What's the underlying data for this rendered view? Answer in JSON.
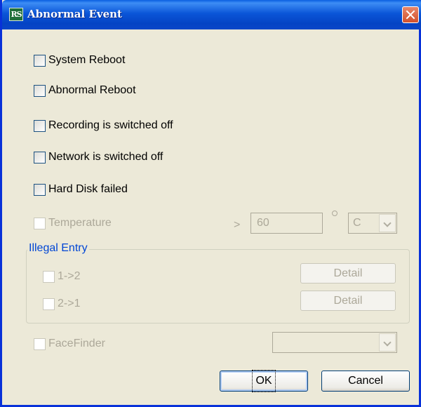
{
  "window": {
    "title": "Abnormal Event",
    "app_icon_text": "RS"
  },
  "events": [
    {
      "label": "System Reboot",
      "checked": false,
      "enabled": true
    },
    {
      "label": "Abnormal Reboot",
      "checked": false,
      "enabled": true
    },
    {
      "label": "Recording is switched off",
      "checked": false,
      "enabled": true
    },
    {
      "label": "Network is switched off",
      "checked": false,
      "enabled": true
    },
    {
      "label": "Hard Disk failed",
      "checked": false,
      "enabled": true
    }
  ],
  "temperature": {
    "label": "Temperature",
    "comparator": ">",
    "value": "60",
    "unit": "C",
    "enabled": false
  },
  "illegal_entry": {
    "title": "Illegal Entry",
    "items": [
      {
        "label": "1->2",
        "button": "Detail"
      },
      {
        "label": "2->1",
        "button": "Detail"
      }
    ]
  },
  "facefinder": {
    "label": "FaceFinder",
    "value": ""
  },
  "buttons": {
    "ok": "OK",
    "cancel": "Cancel"
  },
  "colors": {
    "title_bar": "#0b56d8",
    "group_title": "#0046d5",
    "dialog_bg": "#ece9d8",
    "disabled_text": "#aca899"
  }
}
